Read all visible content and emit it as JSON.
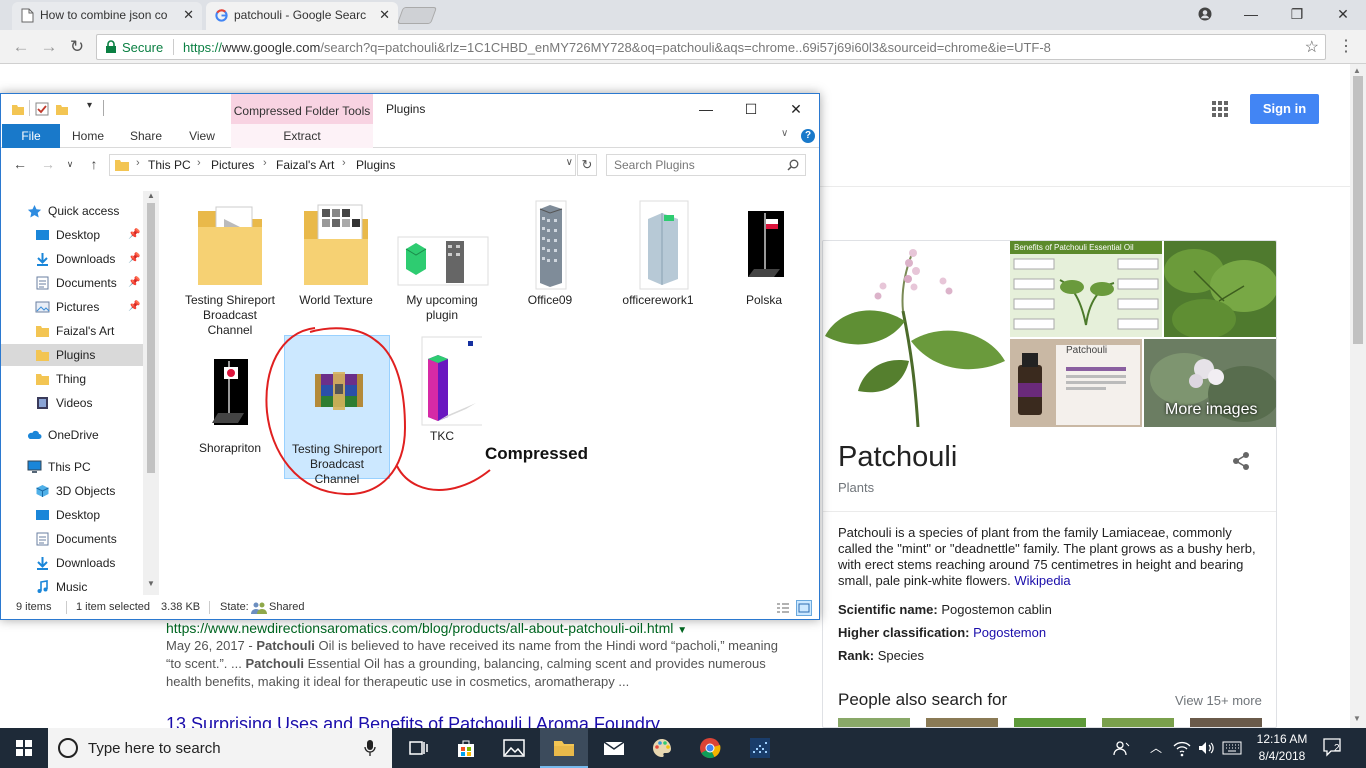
{
  "browser": {
    "tabs": [
      {
        "label": "How to combine json co"
      },
      {
        "label": "patchouli - Google Searc"
      }
    ],
    "secure_label": "Secure",
    "url_scheme": "https://",
    "url_host": "www.google.com",
    "url_path": "/search?q=patchouli&rlz=1C1CHBD_enMY726MY728&oq=patchouli&aqs=chrome..69i57j69i60l3&sourceid=chrome&ie=UTF-8"
  },
  "google": {
    "signin_label": "Sign in",
    "knowledge_panel": {
      "more_images": "More images",
      "title": "Patchouli",
      "subtitle": "Plants",
      "description": "Patchouli is a species of plant from the family Lamiaceae, commonly called the \"mint\" or \"deadnettle\" family. The plant grows as a bushy herb, with erect stems reaching around 75 centimetres in height and bearing small, pale pink-white flowers.",
      "wiki_link": "Wikipedia",
      "facts": [
        {
          "label": "Scientific name:",
          "value": "Pogostemon cablin"
        },
        {
          "label": "Higher classification:",
          "value": "Pogostemon"
        },
        {
          "label": "Rank:",
          "value": "Species"
        }
      ],
      "people_also_search": "People also search for",
      "view_more": "View 15+ more",
      "image_chart_title": "Benefits of Patchouli Essential Oil",
      "image_bottle_title": "Patchouli"
    },
    "results": {
      "url": "https://www.newdirectionsaromatics.com/blog/products/all-about-patchouli-oil.html",
      "snippet_date": "May 26, 2017 - ",
      "snippet_bold1": "Patchouli",
      "snippet_part1": " Oil is believed to have received its name from the Hindi word “pacholi,” meaning “to scent.”. ... ",
      "snippet_bold2": "Patchouli",
      "snippet_part2": " Essential Oil has a grounding, balancing, calming scent and provides numerous health benefits, making it ideal for therapeutic use in cosmetics, aromatherapy ...",
      "next_title": "13 Surprising Uses and Benefits of Patchouli | Aroma Foundry"
    }
  },
  "explorer": {
    "context_tab": "Compressed Folder Tools",
    "title": "Plugins",
    "ribbon_tabs": [
      "File",
      "Home",
      "Share",
      "View",
      "Extract"
    ],
    "breadcrumbs": [
      "This PC",
      "Pictures",
      "Faizal's Art",
      "Plugins"
    ],
    "search_placeholder": "Search Plugins",
    "nav": [
      {
        "label": "Quick access",
        "icon": "star-icon"
      },
      {
        "label": "Desktop",
        "icon": "desktop-icon"
      },
      {
        "label": "Downloads",
        "icon": "download-icon"
      },
      {
        "label": "Documents",
        "icon": "documents-icon"
      },
      {
        "label": "Pictures",
        "icon": "pictures-icon"
      },
      {
        "label": "Faizal's Art",
        "icon": "folder-icon"
      },
      {
        "label": "Plugins",
        "icon": "folder-icon"
      },
      {
        "label": "Thing",
        "icon": "folder-icon"
      },
      {
        "label": "Videos",
        "icon": "videos-icon"
      },
      {
        "label": "OneDrive",
        "icon": "cloud-icon"
      },
      {
        "label": "This PC",
        "icon": "computer-icon"
      },
      {
        "label": "3D Objects",
        "icon": "cube-icon"
      },
      {
        "label": "Desktop",
        "icon": "desktop-icon"
      },
      {
        "label": "Documents",
        "icon": "documents-icon"
      },
      {
        "label": "Downloads",
        "icon": "download-icon"
      },
      {
        "label": "Music",
        "icon": "music-icon"
      }
    ],
    "files": [
      {
        "name": "Testing Shireport Broadcast Channel",
        "type": "folder"
      },
      {
        "name": "World Texture",
        "type": "folder"
      },
      {
        "name": "My upcoming plugin",
        "type": "image"
      },
      {
        "name": "Office09",
        "type": "image"
      },
      {
        "name": "officerework1",
        "type": "image"
      },
      {
        "name": "Polska",
        "type": "image"
      },
      {
        "name": "Shorapriton",
        "type": "image"
      },
      {
        "name": "Testing Shireport Broadcast Channel",
        "type": "archive"
      },
      {
        "name": "TKC",
        "type": "image"
      }
    ],
    "status": {
      "items": "9 items",
      "selected": "1 item selected",
      "size": "3.38 KB",
      "state_label": "State:",
      "state_value": "Shared"
    }
  },
  "annotation": {
    "label": "Compressed"
  },
  "taskbar": {
    "search_placeholder": "Type here to search",
    "time": "12:16 AM",
    "date": "8/4/2018",
    "notifications": "2"
  }
}
